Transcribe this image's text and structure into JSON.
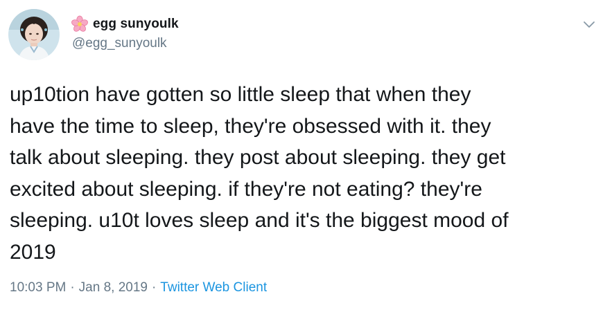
{
  "user": {
    "display_name": "egg sunyoulk",
    "handle": "@egg_sunyoulk",
    "name_emoji_icon": "cherry-blossom-icon",
    "avatar_icon": "profile-photo"
  },
  "tweet": {
    "text": "up10tion have gotten so little sleep that when they\nhave the time to sleep, they're obsessed with it. they\ntalk about sleeping. they post about sleeping. they get\nexcited about sleeping. if they're not eating? they're\nsleeping. u10t loves sleep and it's the biggest mood of\n2019"
  },
  "meta": {
    "time": "10:03 PM",
    "separator": "·",
    "date": "Jan 8, 2019",
    "source": "Twitter Web Client"
  },
  "menu": {
    "icon": "chevron-down-icon"
  },
  "colors": {
    "text": "#14171a",
    "secondary": "#657786",
    "link": "#1b95e0",
    "background": "#ffffff"
  }
}
